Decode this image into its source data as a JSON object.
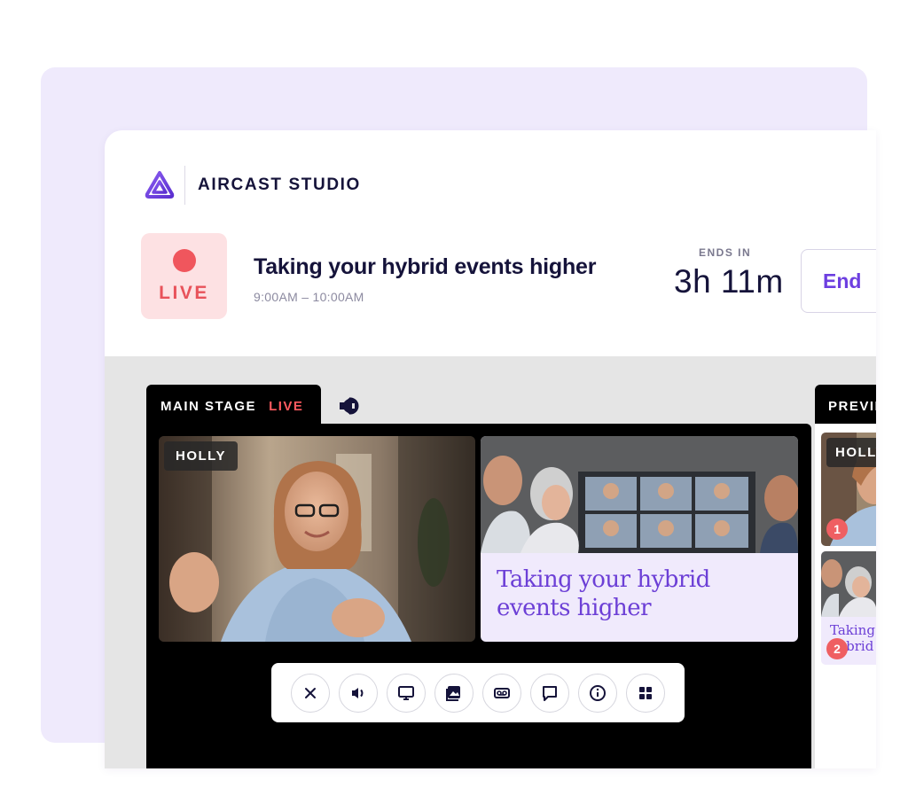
{
  "app": {
    "name": "AIRCAST STUDIO",
    "logo_icon": "aircast-logo-icon"
  },
  "event": {
    "status_label": "LIVE",
    "title": "Taking your hybrid events higher",
    "time_range": "9:00AM – 10:00AM",
    "ends_in_label": "ENDS IN",
    "ends_in_value": "3h 11m",
    "end_button_label": "End"
  },
  "main_stage": {
    "tab_label": "MAIN STAGE",
    "live_label": "LIVE",
    "speaker_icon": "speaker-icon",
    "video1_name": "HOLLY",
    "video2_caption": "Taking your hybrid events higher"
  },
  "toolbar": {
    "buttons": [
      {
        "name": "close-button",
        "icon": "close-icon"
      },
      {
        "name": "audio-button",
        "icon": "speaker-icon"
      },
      {
        "name": "screen-share-button",
        "icon": "monitor-icon"
      },
      {
        "name": "media-button",
        "icon": "image-icon"
      },
      {
        "name": "recording-button",
        "icon": "voicemail-icon"
      },
      {
        "name": "chat-button",
        "icon": "chat-icon"
      },
      {
        "name": "info-button",
        "icon": "info-icon"
      },
      {
        "name": "layout-button",
        "icon": "grid-icon"
      }
    ]
  },
  "preview": {
    "tab_label": "PREVIEW",
    "items": [
      {
        "name": "HOLLY",
        "number": "1"
      },
      {
        "caption": "Taking your hybrid events",
        "number": "2"
      }
    ]
  },
  "colors": {
    "accent": "#6d3fe0",
    "live_red": "#f0565d",
    "background_panel": "#efeafc",
    "caption_bg": "#f0eafc"
  }
}
